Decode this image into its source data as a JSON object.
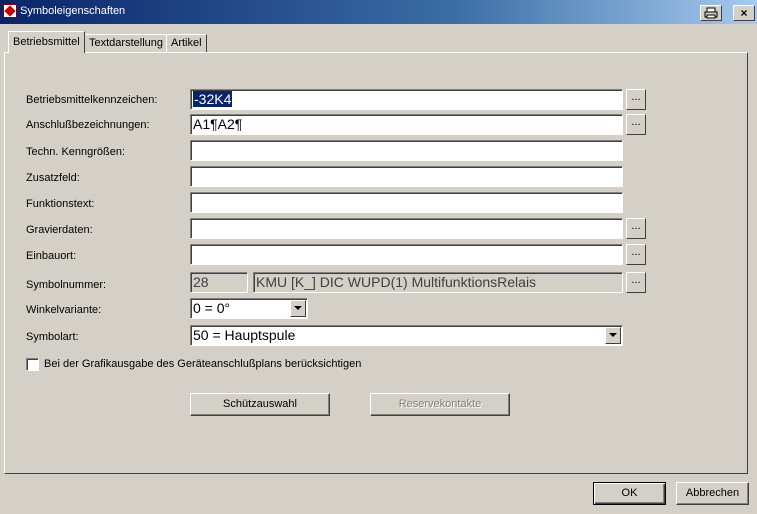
{
  "window": {
    "title": "Symboleigenschaften",
    "print_icon": "printer-icon",
    "close_label": "×"
  },
  "tabs": [
    {
      "label": "Betriebsmittel",
      "active": true
    },
    {
      "label": "Textdarstellung",
      "active": false
    },
    {
      "label": "Artikel",
      "active": false
    }
  ],
  "fields": {
    "betriebsmittelkennzeichen": {
      "label": "Betriebsmittelkennzeichen:",
      "value": "-32K4"
    },
    "anschluss": {
      "label": "Anschlußbezeichnungen:",
      "value": "A1¶A2¶"
    },
    "techn": {
      "label": "Techn. Kenngrößen:",
      "value": ""
    },
    "zusatzfeld": {
      "label": "Zusatzfeld:",
      "value": ""
    },
    "funktionstext": {
      "label": "Funktionstext:",
      "value": ""
    },
    "gravierdaten": {
      "label": "Gravierdaten:",
      "value": ""
    },
    "einbauort": {
      "label": "Einbauort:",
      "value": ""
    },
    "symbolnummer": {
      "label": "Symbolnummer:",
      "number": "28",
      "description": "KMU [K_] DIC  WUPD(1) MultifunktionsRelais"
    },
    "winkelvariante": {
      "label": "Winkelvariante:",
      "value": "0 = 0°"
    },
    "symbolart": {
      "label": "Symbolart:",
      "value": "50 = Hauptspule"
    }
  },
  "ellipsis_label": "...",
  "checkbox": {
    "label": "Bei der Grafikausgabe des Geräteanschlußplans berücksichtigen",
    "checked": false
  },
  "buttons": {
    "schuetzauswahl": "Schützauswahl",
    "reservekontakte": "Reservekontakte",
    "ok": "OK",
    "abbrechen": "Abbrechen"
  }
}
